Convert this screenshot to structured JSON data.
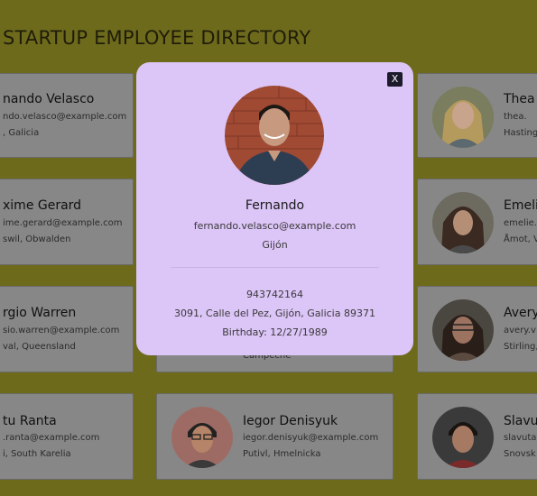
{
  "page": {
    "title": "STARTUP EMPLOYEE DIRECTORY"
  },
  "cards": [
    {
      "name": "nando Velasco",
      "email": "ndo.velasco@example.com",
      "location": ", Galicia"
    },
    {
      "name": "Thea",
      "email": "thea.",
      "location": "Hasting"
    },
    {
      "name": "xime Gerard",
      "email": "ime.gerard@example.com",
      "location": "swil, Obwalden"
    },
    {
      "name": "Emeli",
      "email": "emelie.",
      "location": "Åmot, V"
    },
    {
      "name": "rgio Warren",
      "email": "sio.warren@example.com",
      "location": "val, Queensland"
    },
    {
      "name": "",
      "email": "",
      "location": "Campeche"
    },
    {
      "name": "Avery",
      "email": "avery.v",
      "location": "Stirling,"
    },
    {
      "name": "tu Ranta",
      "email": ".ranta@example.com",
      "location": "i, South Karelia"
    },
    {
      "name": "Iegor Denisyuk",
      "email": "iegor.denisyuk@example.com",
      "location": "Putivl, Hmelnicka"
    },
    {
      "name": "Slavut",
      "email": "slavuta.",
      "location": "Snovsk"
    }
  ],
  "modal": {
    "close_label": "X",
    "name": "Fernando",
    "email": "fernando.velasco@example.com",
    "city": "Gijón",
    "phone": "943742164",
    "address": "3091, Calle del Pez, Gijón, Galicia 89371",
    "birthday": "Birthday: 12/27/1989"
  }
}
